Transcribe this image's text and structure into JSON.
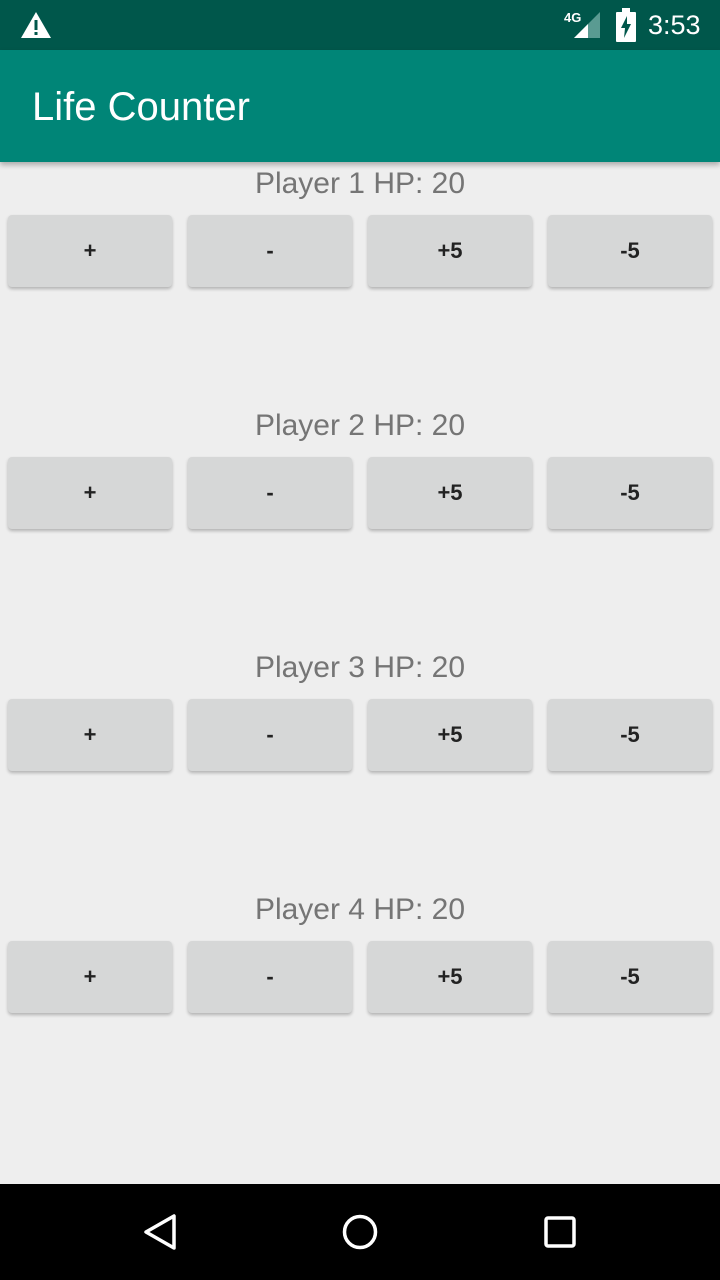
{
  "status_bar": {
    "network": "4G",
    "time": "3:53",
    "icons": [
      "warning-icon",
      "signal-icon",
      "battery-charging-icon"
    ]
  },
  "app_bar": {
    "title": "Life Counter"
  },
  "players": [
    {
      "label": "Player 1 HP: 20",
      "buttons": [
        "+",
        "-",
        "+5",
        "-5"
      ]
    },
    {
      "label": "Player 2 HP: 20",
      "buttons": [
        "+",
        "-",
        "+5",
        "-5"
      ]
    },
    {
      "label": "Player 3 HP: 20",
      "buttons": [
        "+",
        "-",
        "+5",
        "-5"
      ]
    },
    {
      "label": "Player 4 HP: 20",
      "buttons": [
        "+",
        "-",
        "+5",
        "-5"
      ]
    }
  ],
  "nav_bar": {
    "icons": [
      "back-icon",
      "home-icon",
      "recents-icon"
    ]
  },
  "colors": {
    "status_bar": "#00574b",
    "app_bar": "#008577",
    "background": "#eeeeee",
    "button": "#d6d7d7",
    "label_text": "#757575"
  }
}
